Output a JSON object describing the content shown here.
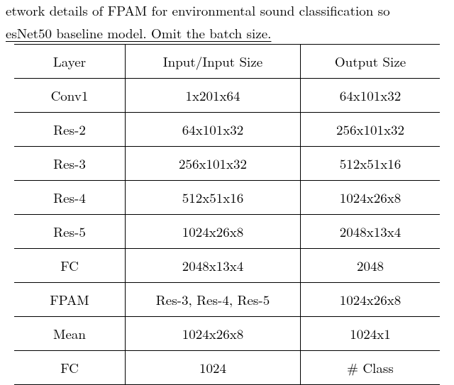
{
  "caption": {
    "line1": "etwork details of FPAM for environmental sound classification so",
    "line2": "esNet50 baseline model. Omit the batch size."
  },
  "table": {
    "headers": [
      "Layer",
      "Input/Input Size",
      "Output Size"
    ],
    "rows": [
      [
        "Conv1",
        "1x201x64",
        "64x101x32"
      ],
      [
        "Res-2",
        "64x101x32",
        "256x101x32"
      ],
      [
        "Res-3",
        "256x101x32",
        "512x51x16"
      ],
      [
        "Res-4",
        "512x51x16",
        "1024x26x8"
      ],
      [
        "Res-5",
        "1024x26x8",
        "2048x13x4"
      ],
      [
        "FC",
        "2048x13x4",
        "2048"
      ],
      [
        "FPAM",
        "Res-3, Res-4, Res-5",
        "1024x26x8"
      ],
      [
        "Mean",
        "1024x26x8",
        "1024x1"
      ],
      [
        "FC",
        "1024",
        "# Class"
      ]
    ]
  }
}
